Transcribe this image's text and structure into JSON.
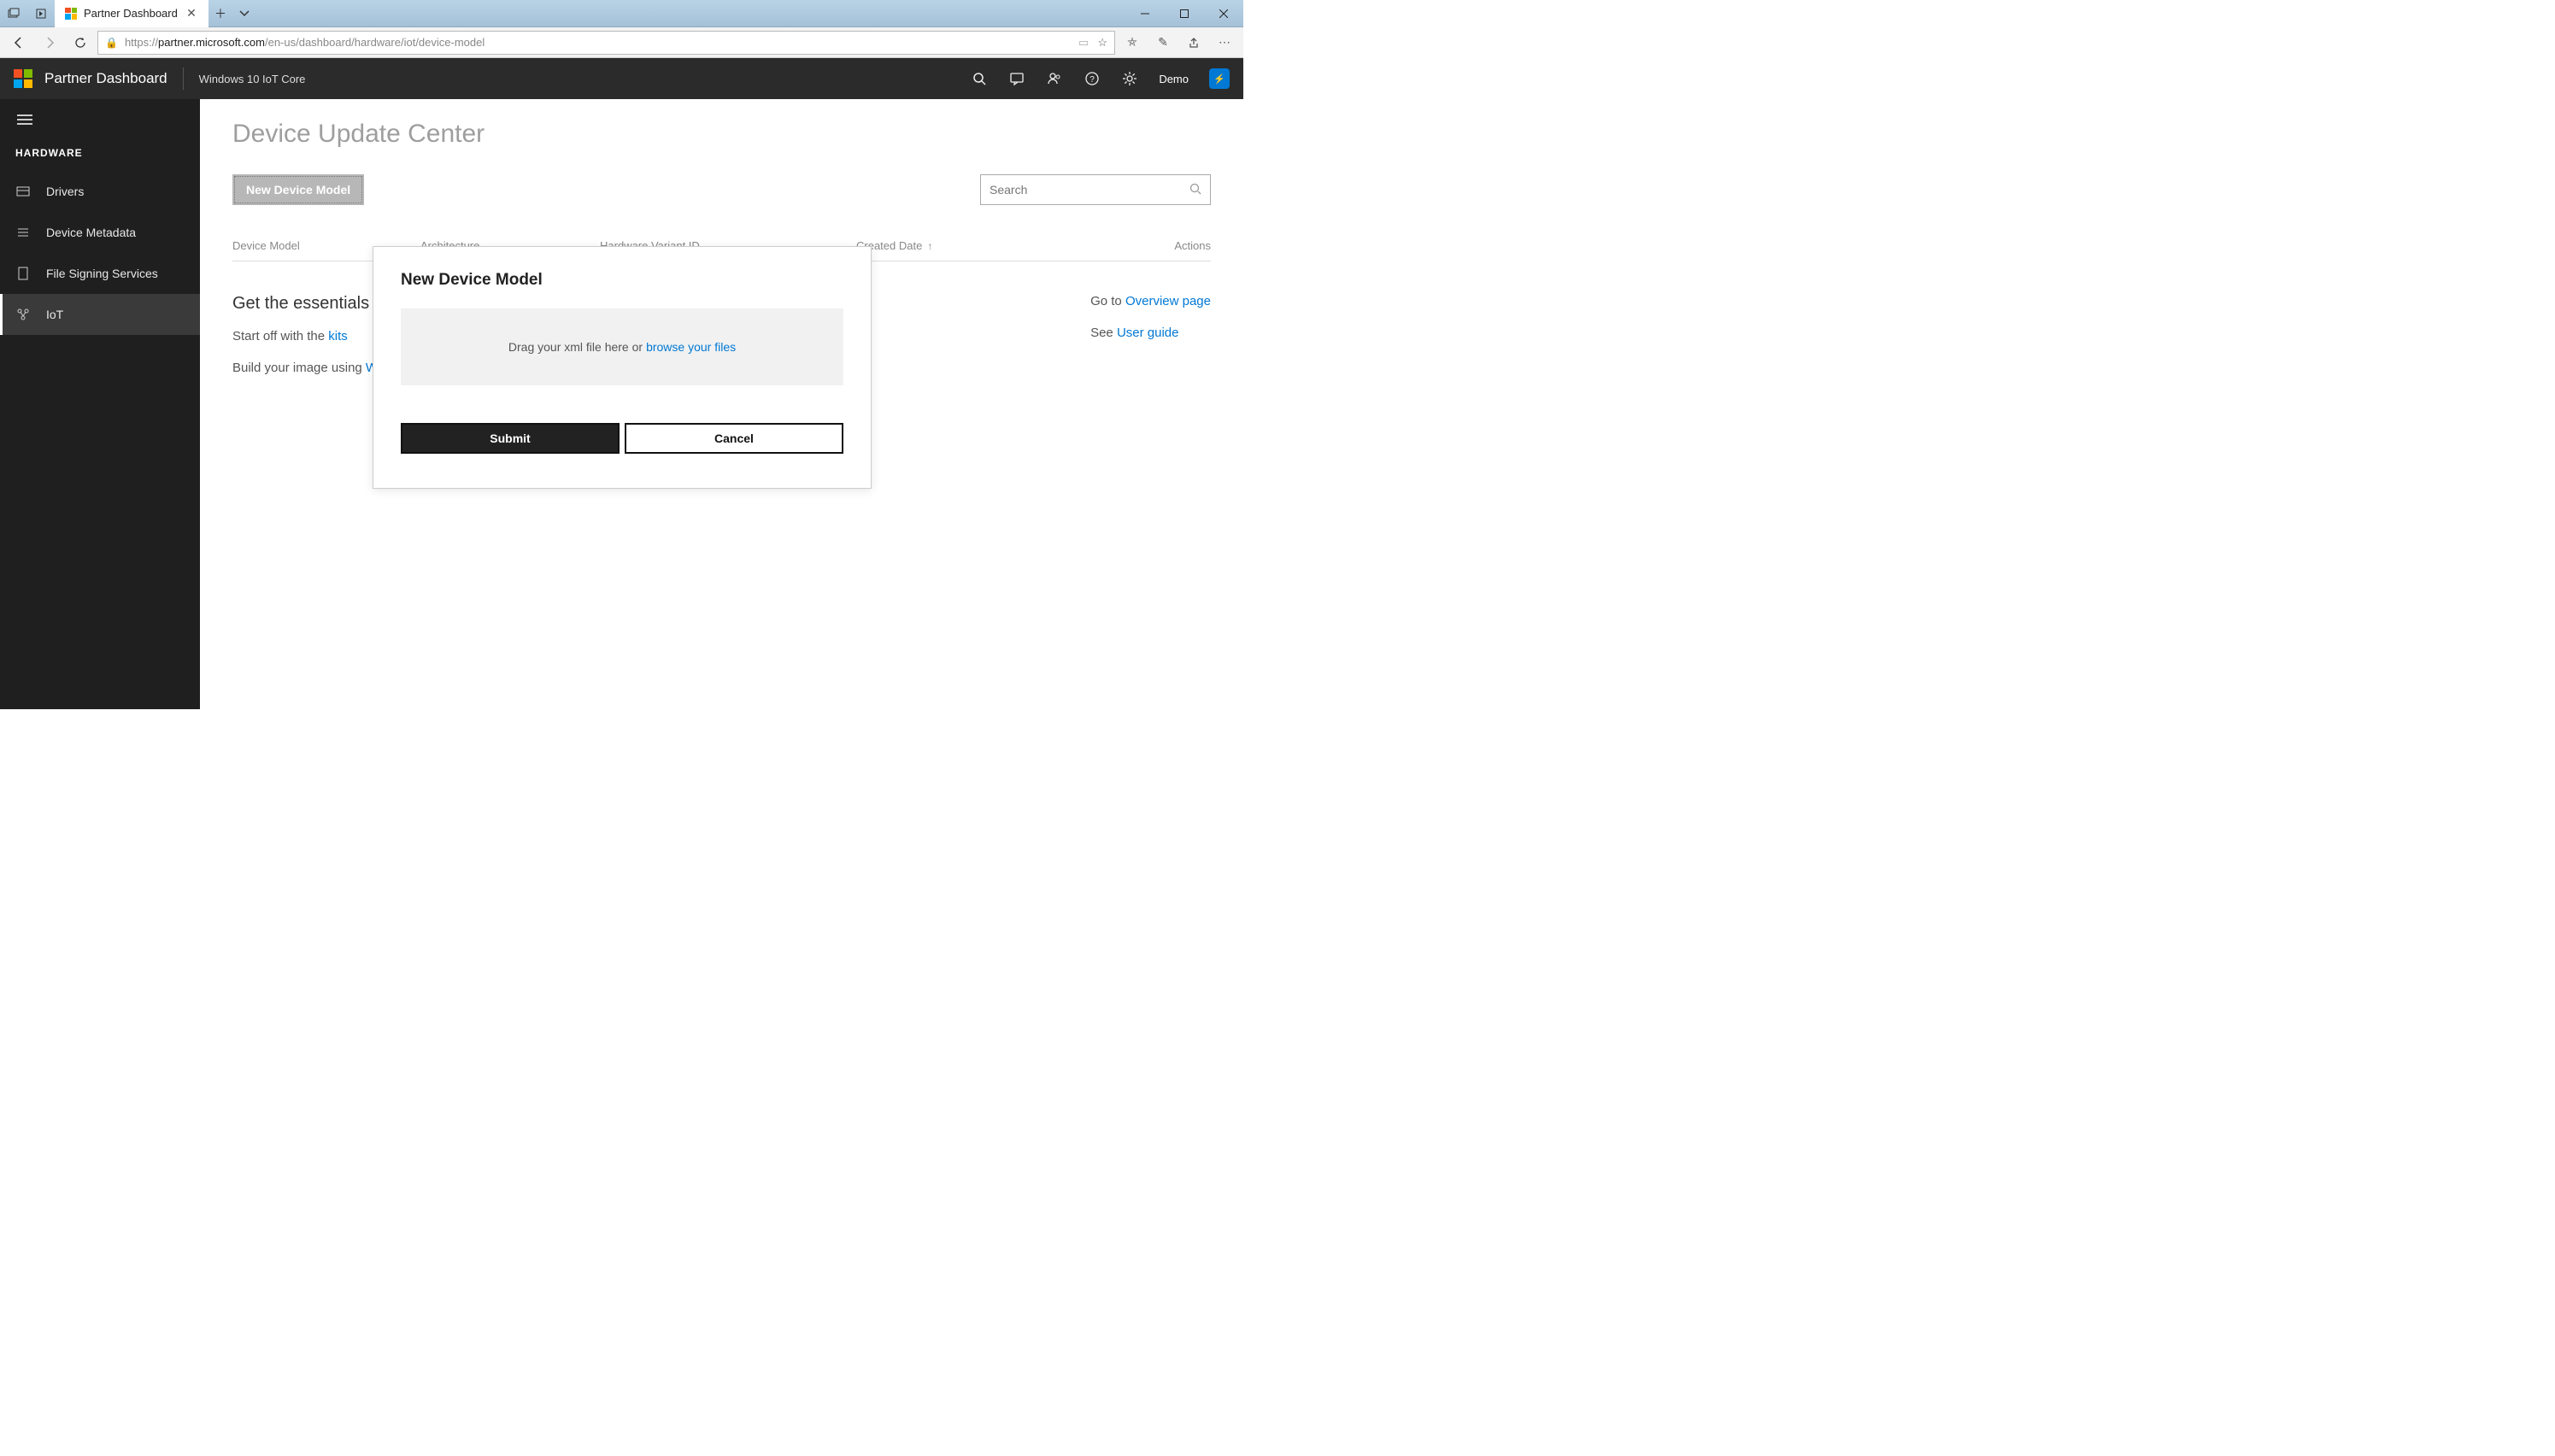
{
  "browser": {
    "tab_title": "Partner Dashboard",
    "url_prefix": "https://",
    "url_host": "partner.microsoft.com",
    "url_path": "/en-us/dashboard/hardware/iot/device-model"
  },
  "header": {
    "brand": "Partner Dashboard",
    "subtitle": "Windows 10 IoT Core",
    "user_name": "Demo"
  },
  "sidebar": {
    "section": "HARDWARE",
    "items": [
      {
        "label": "Drivers"
      },
      {
        "label": "Device Metadata"
      },
      {
        "label": "File Signing Services"
      },
      {
        "label": "IoT"
      }
    ]
  },
  "page": {
    "title": "Device Update Center",
    "new_device_label": "New Device Model",
    "search_placeholder": "Search",
    "columns": {
      "c1": "Device Model",
      "c2": "Architecture",
      "c3": "Hardware Variant ID",
      "c4": "Created Date",
      "c5": "Actions"
    },
    "essentials": {
      "heading": "Get the essentials",
      "line1_prefix": "Start off with the ",
      "line1_link": "kits",
      "line2_prefix": "Build your image using ",
      "right1_prefix": "Go to ",
      "right1_link": "Overview page",
      "right2_prefix": "See ",
      "right2_link": "User guide"
    }
  },
  "modal": {
    "title": "New Device Model",
    "drop_text": "Drag your xml file here or",
    "browse_text": "browse your files",
    "submit": "Submit",
    "cancel": "Cancel"
  }
}
